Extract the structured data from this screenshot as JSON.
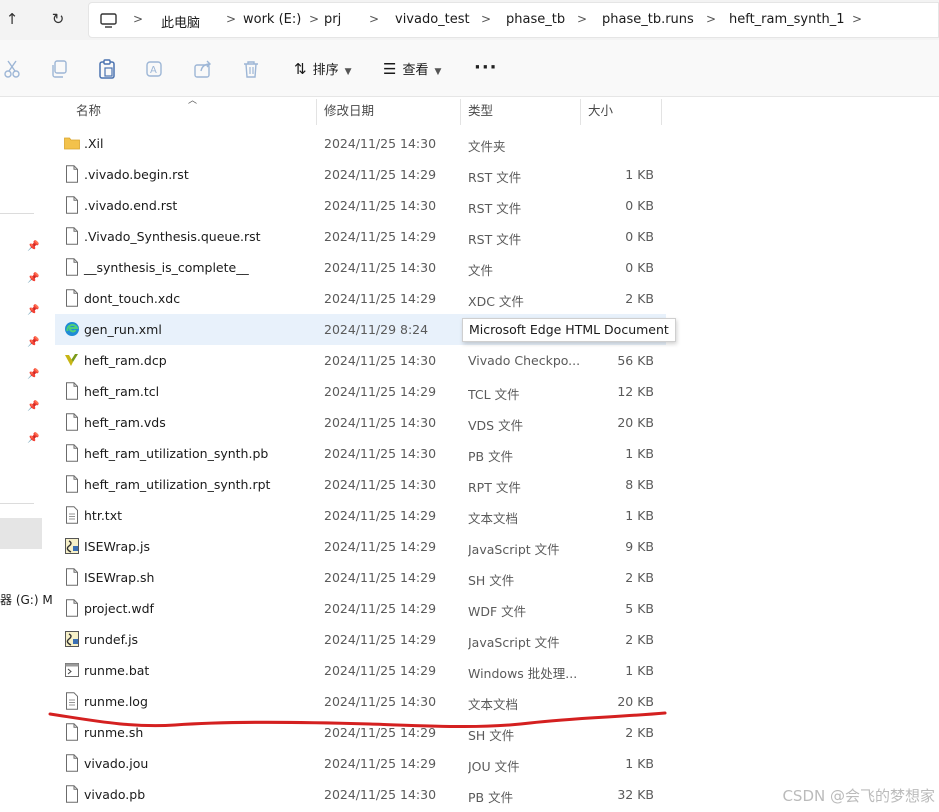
{
  "addressbar": {
    "nav_up": "↑",
    "nav_refresh": "↻",
    "crumbs": [
      "此电脑",
      "work (E:)",
      "prj",
      "vivado_test",
      "phase_tb",
      "phase_tb.runs",
      "heft_ram_synth_1"
    ]
  },
  "toolbar": {
    "sort_label": "排序",
    "view_label": "查看",
    "more_label": "···",
    "icons": [
      "cut-icon",
      "copy-icon",
      "paste-icon",
      "rename-icon",
      "share-icon",
      "delete-icon"
    ]
  },
  "leftnav": {
    "drive_label": "器 (G:) M"
  },
  "columns": {
    "name": "名称",
    "date": "修改日期",
    "type": "类型",
    "size": "大小"
  },
  "files": [
    {
      "name": ".Xil",
      "date": "2024/11/25 14:30",
      "type": "文件夹",
      "size": "",
      "icon": "folder"
    },
    {
      "name": ".vivado.begin.rst",
      "date": "2024/11/25 14:29",
      "type": "RST 文件",
      "size": "1 KB",
      "icon": "file"
    },
    {
      "name": ".vivado.end.rst",
      "date": "2024/11/25 14:30",
      "type": "RST 文件",
      "size": "0 KB",
      "icon": "file"
    },
    {
      "name": ".Vivado_Synthesis.queue.rst",
      "date": "2024/11/25 14:29",
      "type": "RST 文件",
      "size": "0 KB",
      "icon": "file"
    },
    {
      "name": "__synthesis_is_complete__",
      "date": "2024/11/25 14:30",
      "type": "文件",
      "size": "0 KB",
      "icon": "file"
    },
    {
      "name": "dont_touch.xdc",
      "date": "2024/11/25 14:29",
      "type": "XDC 文件",
      "size": "2 KB",
      "icon": "file"
    },
    {
      "name": "gen_run.xml",
      "date": "2024/11/29 8:24",
      "type": "Microsoft Edge HTML Document",
      "size": "",
      "icon": "edge"
    },
    {
      "name": "heft_ram.dcp",
      "date": "2024/11/25 14:30",
      "type": "Vivado Checkpo...",
      "size": "56 KB",
      "icon": "vivado"
    },
    {
      "name": "heft_ram.tcl",
      "date": "2024/11/25 14:29",
      "type": "TCL 文件",
      "size": "12 KB",
      "icon": "file"
    },
    {
      "name": "heft_ram.vds",
      "date": "2024/11/25 14:30",
      "type": "VDS 文件",
      "size": "20 KB",
      "icon": "file"
    },
    {
      "name": "heft_ram_utilization_synth.pb",
      "date": "2024/11/25 14:30",
      "type": "PB 文件",
      "size": "1 KB",
      "icon": "file"
    },
    {
      "name": "heft_ram_utilization_synth.rpt",
      "date": "2024/11/25 14:30",
      "type": "RPT 文件",
      "size": "8 KB",
      "icon": "file"
    },
    {
      "name": "htr.txt",
      "date": "2024/11/25 14:29",
      "type": "文本文档",
      "size": "1 KB",
      "icon": "text"
    },
    {
      "name": "ISEWrap.js",
      "date": "2024/11/25 14:29",
      "type": "JavaScript 文件",
      "size": "9 KB",
      "icon": "script"
    },
    {
      "name": "ISEWrap.sh",
      "date": "2024/11/25 14:29",
      "type": "SH 文件",
      "size": "2 KB",
      "icon": "file"
    },
    {
      "name": "project.wdf",
      "date": "2024/11/25 14:29",
      "type": "WDF 文件",
      "size": "5 KB",
      "icon": "file"
    },
    {
      "name": "rundef.js",
      "date": "2024/11/25 14:29",
      "type": "JavaScript 文件",
      "size": "2 KB",
      "icon": "script"
    },
    {
      "name": "runme.bat",
      "date": "2024/11/25 14:29",
      "type": "Windows 批处理...",
      "size": "1 KB",
      "icon": "bat"
    },
    {
      "name": "runme.log",
      "date": "2024/11/25 14:30",
      "type": "文本文档",
      "size": "20 KB",
      "icon": "text"
    },
    {
      "name": "runme.sh",
      "date": "2024/11/25 14:29",
      "type": "SH 文件",
      "size": "2 KB",
      "icon": "file"
    },
    {
      "name": "vivado.jou",
      "date": "2024/11/25 14:29",
      "type": "JOU 文件",
      "size": "1 KB",
      "icon": "file"
    },
    {
      "name": "vivado.pb",
      "date": "2024/11/25 14:30",
      "type": "PB 文件",
      "size": "32 KB",
      "icon": "file"
    }
  ],
  "hovered_index": 6,
  "tooltip": "Microsoft Edge HTML Document",
  "watermark": "CSDN @会飞的梦想家",
  "colors": {
    "annotation_line": "#d42020",
    "hover_row": "#e8f1fb",
    "folder": "#f3c24b"
  }
}
